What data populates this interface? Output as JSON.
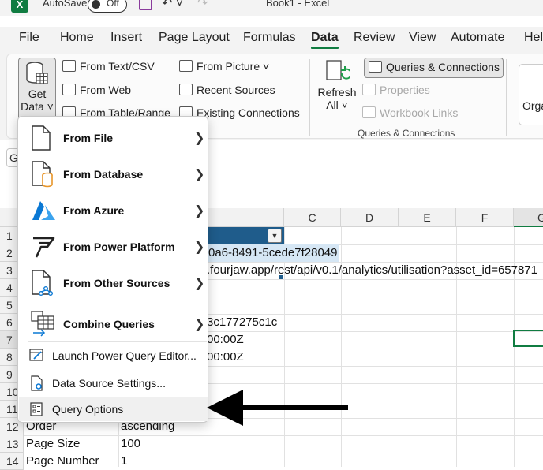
{
  "titlebar": {
    "logo": "X",
    "autosave_label": "AutoSave",
    "autosave_state": "Off",
    "document_title": "Book1  -  Excel"
  },
  "tabs": [
    "File",
    "Home",
    "Insert",
    "Page Layout",
    "Formulas",
    "Data",
    "Review",
    "View",
    "Automate",
    "Hel"
  ],
  "active_tab": "Data",
  "ribbon": {
    "get_data_line1": "Get",
    "get_data_line2": "Data ˅",
    "get_transform": {
      "from_text_csv": "From Text/CSV",
      "from_web": "From Web",
      "from_table_range": "From Table/Range",
      "from_picture": "From Picture ˅",
      "recent_sources": "Recent Sources",
      "existing_connections": "Existing Connections"
    },
    "refresh_line1": "Refresh",
    "refresh_line2": "All ˅",
    "queries_connections": "Queries & Connections",
    "properties": "Properties",
    "workbook_links": "Workbook Links",
    "group_label": "Queries & Connections",
    "organize_partial": "Orga"
  },
  "namebox_value": "G",
  "columns": [
    "C",
    "D",
    "E",
    "F",
    "G"
  ],
  "rows": [
    "1",
    "2",
    "3",
    "4",
    "5",
    "6",
    "7",
    "8",
    "9",
    "10",
    "11",
    "12",
    "13",
    "14"
  ],
  "cells": {
    "r2": "0a6-8491-5cede7f28049",
    "r3": ".fourjaw.app/rest/api/v0.1/analytics/utilisation?asset_id=657871",
    "r6": "3c177275c1c",
    "r7": "00:00Z",
    "r8": "00:00Z",
    "r12a": "Order",
    "r12b": "ascending",
    "r13a": "Page Size",
    "r13b": "100",
    "r14a": "Page Number",
    "r14b": "1"
  },
  "menu": {
    "from_file": "From File",
    "from_database": "From Database",
    "from_azure": "From Azure",
    "from_power_platform": "From Power Platform",
    "from_other_sources": "From Other Sources",
    "combine_queries": "Combine Queries",
    "launch_pqe": "Launch Power Query Editor...",
    "data_source_settings": "Data Source Settings...",
    "query_options": "Query Options"
  },
  "colors": {
    "excel_green": "#107c41",
    "table_header": "#1f5c8b",
    "database_orange": "#e8962a",
    "azure_blue": "#0a78d4"
  }
}
